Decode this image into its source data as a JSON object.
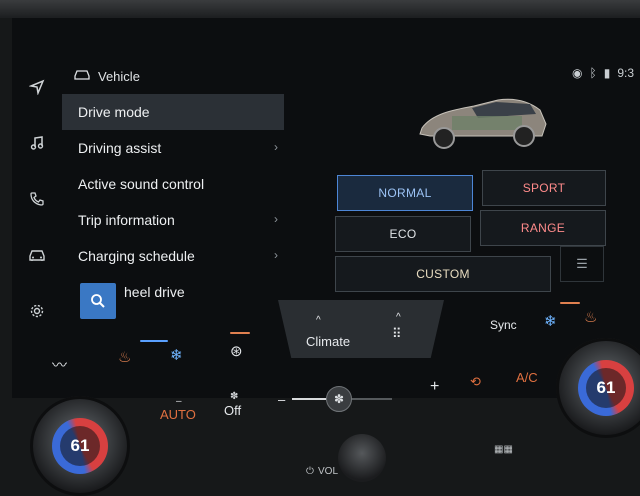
{
  "header": {
    "title": "Vehicle",
    "car_icon": "car-icon"
  },
  "status": {
    "time": "9:3",
    "icons": [
      "location-icon",
      "bluetooth-icon",
      "signal-icon"
    ]
  },
  "rail": [
    "navigation-icon",
    "music-icon",
    "phone-icon",
    "car-icon",
    "gear-icon"
  ],
  "menu": {
    "items": [
      {
        "label": "Drive mode",
        "active": true
      },
      {
        "label": "Driving assist",
        "chevron": "›"
      },
      {
        "label": "Active sound control"
      },
      {
        "label": "Trip information",
        "chevron": "›"
      },
      {
        "label": "Charging schedule",
        "chevron": "›"
      },
      {
        "label": "heel drive"
      }
    ],
    "search_icon": "search-icon"
  },
  "drive_modes": {
    "normal": "NORMAL",
    "sport": "SPORT",
    "eco": "ECO",
    "range": "RANGE",
    "custom": "CUSTOM",
    "selected": "NORMAL"
  },
  "climate": {
    "tab_label": "Climate",
    "tab_chevron": "^",
    "sync_label": "Sync",
    "auto_label": "AUTO",
    "off_label": "Off",
    "ac_label": "A/C",
    "minus": "–",
    "plus": "+",
    "dash": "–",
    "vol_label": "VOL",
    "temp_left": "61",
    "temp_right": "61"
  },
  "colors": {
    "accent": "#4d86d6",
    "warn": "#ff8b8b",
    "heat": "#e07040"
  }
}
